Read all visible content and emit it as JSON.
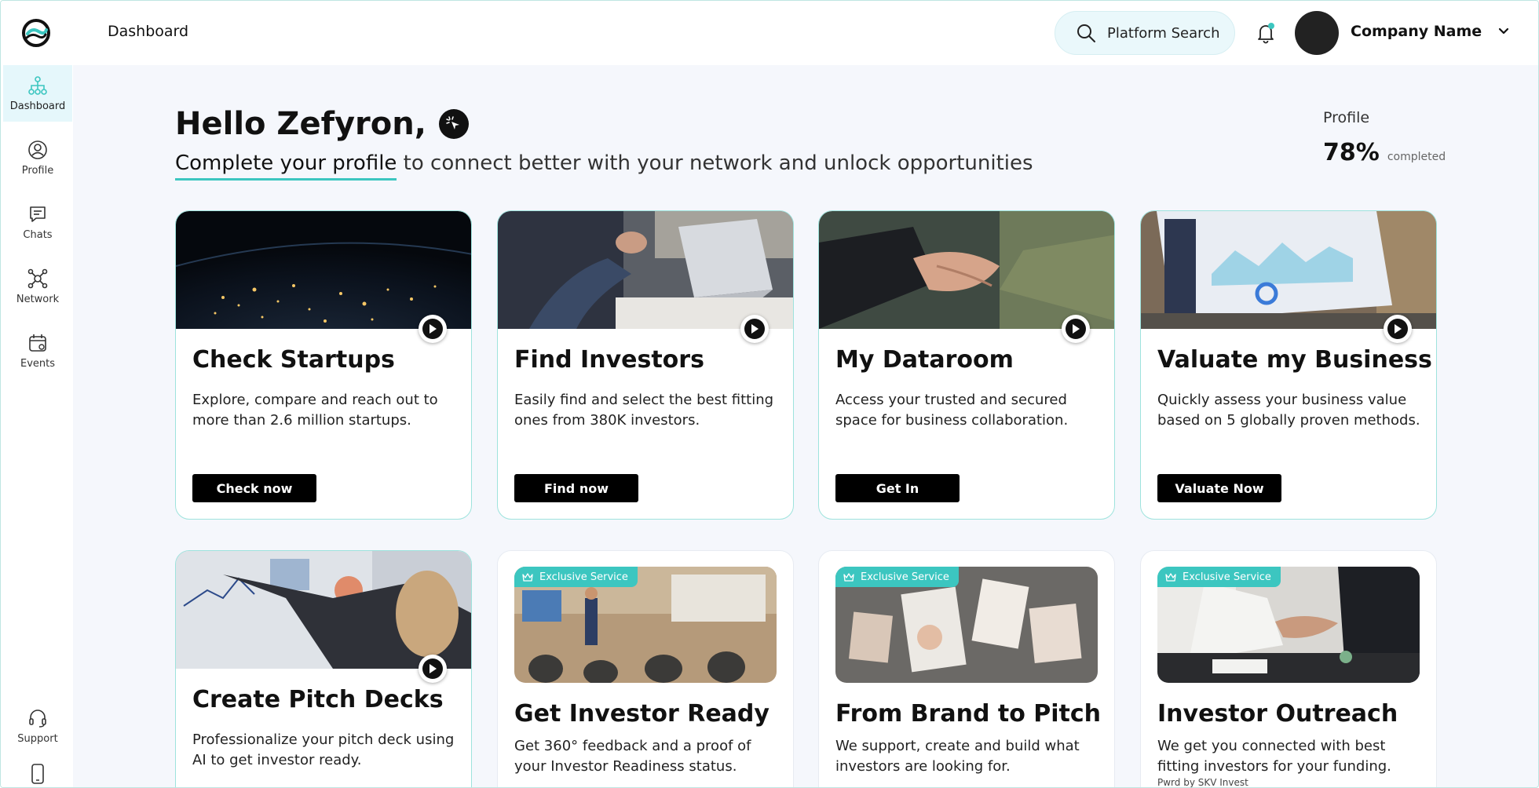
{
  "header": {
    "title": "Dashboard",
    "search_label": "Platform Search",
    "company_name": "Company Name"
  },
  "sidebar": {
    "items": [
      {
        "label": "Dashboard",
        "icon": "hierarchy-icon"
      },
      {
        "label": "Profile",
        "icon": "user-circle-icon"
      },
      {
        "label": "Chats",
        "icon": "chat-icon"
      },
      {
        "label": "Network",
        "icon": "network-icon"
      },
      {
        "label": "Events",
        "icon": "calendar-icon"
      },
      {
        "label": "Support",
        "icon": "headset-icon"
      }
    ]
  },
  "main": {
    "greeting": "Hello Zefyron,",
    "sub_link": "Complete your profile",
    "sub_rest": " to connect better with your network and unlock opportunities",
    "profile_label": "Profile",
    "profile_percent": "78%",
    "profile_completed": "completed",
    "profile_value": 0.78
  },
  "cards": [
    {
      "title": "Check Startups",
      "desc": "Explore, compare and reach out to more than 2.6 million startups.",
      "button": "Check now"
    },
    {
      "title": "Find Investors",
      "desc": "Easily find and select the best fitting ones from 380K investors.",
      "button": "Find now"
    },
    {
      "title": "My Dataroom",
      "desc": "Access your trusted and secured space for  business collaboration.",
      "button": "Get In"
    },
    {
      "title": "Valuate my Business",
      "desc": "Quickly assess your business value based on 5 globally proven methods.",
      "button": "Valuate Now"
    },
    {
      "title": "Create Pitch Decks",
      "desc": "Professionalize your pitch deck using AI to get investor ready."
    },
    {
      "badge": "Exclusive Service",
      "title": "Get Investor Ready",
      "desc": "Get 360° feedback and a proof of your Investor Readiness status."
    },
    {
      "badge": "Exclusive Service",
      "title": "From Brand to Pitch",
      "desc": "We support, create and build what investors are looking for."
    },
    {
      "badge": "Exclusive Service",
      "title": "Investor Outreach",
      "desc": "We get you connected with best fitting investors for your funding.",
      "note": "Pwrd by SKV Invest"
    }
  ],
  "colors": {
    "accent": "#3cc6c0",
    "page_bg": "#f5f7fc",
    "button_bg": "#000000"
  }
}
